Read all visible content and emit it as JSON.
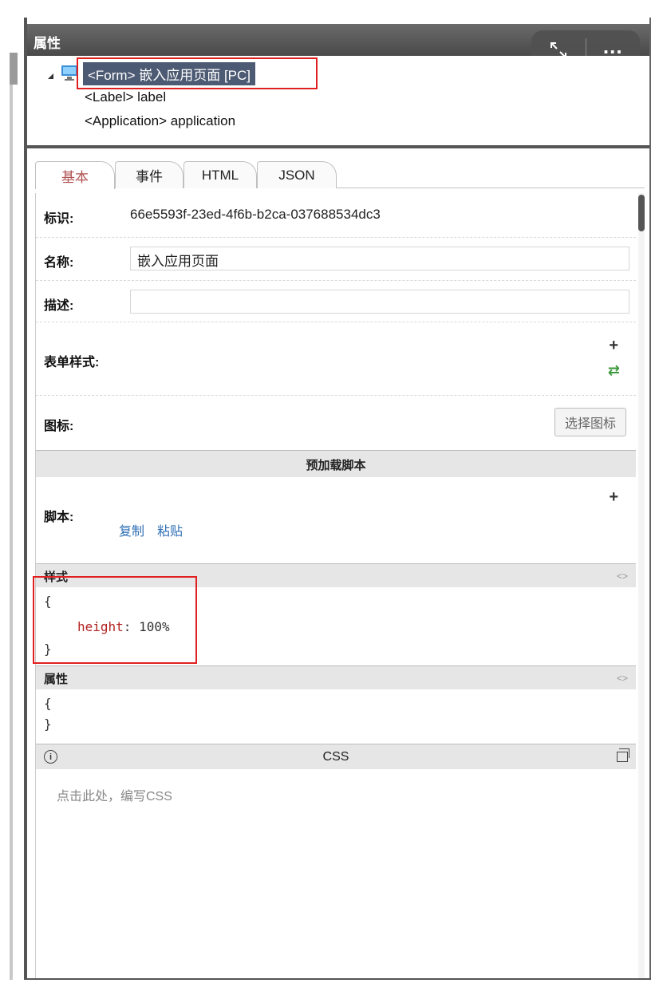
{
  "panel": {
    "title": "属性"
  },
  "overlay": {
    "expand_icon": "expand-icon",
    "more_label": "..."
  },
  "tree": {
    "items": [
      {
        "label": "<Form> 嵌入应用页面 [PC]",
        "selected": true,
        "icon": "monitor-icon"
      },
      {
        "label": "<Label> label"
      },
      {
        "label": "<Application> application"
      }
    ]
  },
  "tabs": [
    {
      "label": "基本",
      "active": true
    },
    {
      "label": "事件"
    },
    {
      "label": "HTML"
    },
    {
      "label": "JSON"
    }
  ],
  "props": {
    "id_label": "标识:",
    "id_value": "66e5593f-23ed-4f6b-b2ca-037688534dc3",
    "name_label": "名称:",
    "name_value": "嵌入应用页面",
    "desc_label": "描述:",
    "desc_value": "",
    "form_style_label": "表单样式:",
    "icon_label": "图标:",
    "icon_button": "选择图标"
  },
  "preload": {
    "section_title": "预加载脚本",
    "script_label": "脚本:",
    "copy_link": "复制",
    "paste_link": "粘贴"
  },
  "style_block": {
    "title": "样式",
    "open": "{",
    "key": "height",
    "value": ": 100%",
    "close": "}"
  },
  "attr_block": {
    "title": "属性",
    "open": "{",
    "close": "}"
  },
  "css_block": {
    "title": "CSS",
    "placeholder": "点击此处，编写CSS"
  },
  "colors": {
    "selected_bg": "#4d5a73",
    "highlight_border": "#e02020",
    "link": "#2f6fb5",
    "code_key": "#b22222",
    "active_tab": "#b05050"
  }
}
